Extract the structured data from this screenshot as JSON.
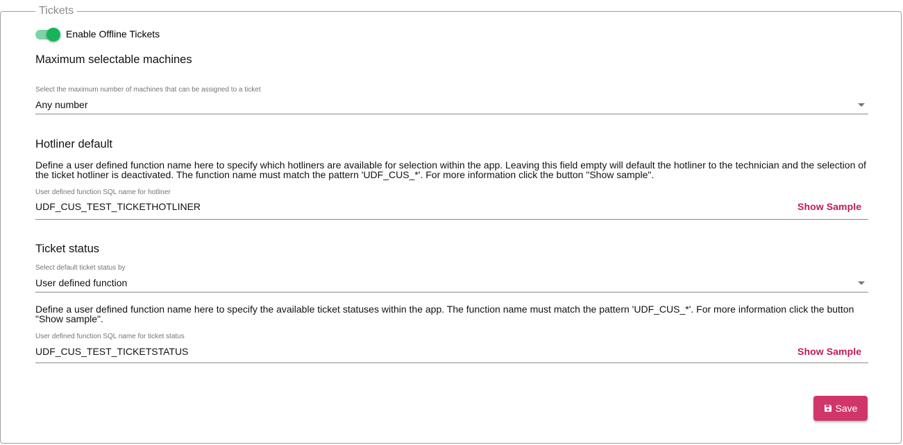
{
  "section": {
    "legend": "Tickets"
  },
  "offline": {
    "label": "Enable Offline Tickets",
    "enabled": true
  },
  "machines": {
    "heading": "Maximum selectable machines",
    "select_label": "Select the maximum number of machines that can be assigned to a ticket",
    "select_value": "Any number"
  },
  "hotliner": {
    "heading": "Hotliner default",
    "description": "Define a user defined function name here to specify which hotliners are available for selection within the app. Leaving this field empty will default the hotliner to the technician and the selection of the ticket hotliner is deactivated. The function name must match the pattern 'UDF_CUS_*'. For more information click the button \"Show sample\".",
    "field_label": "User defined function SQL name for hotliner",
    "field_value": "UDF_CUS_TEST_TICKETHOTLINER",
    "sample_button": "Show Sample"
  },
  "status": {
    "heading": "Ticket status",
    "select_label": "Select default ticket status by",
    "select_value": "User defined function",
    "description": "Define a user defined function name here to specify the available ticket statuses within the app. The function name must match the pattern 'UDF_CUS_*'. For more information click the button \"Show sample\".",
    "field_label": "User defined function SQL name for ticket status",
    "field_value": "UDF_CUS_TEST_TICKETSTATUS",
    "sample_button": "Show Sample"
  },
  "actions": {
    "save_label": "Save",
    "save_icon": "floppy-disk-icon"
  },
  "colors": {
    "toggle_on": "#16b55d",
    "accent": "#c2185b",
    "save_bg": "#d1366a"
  }
}
